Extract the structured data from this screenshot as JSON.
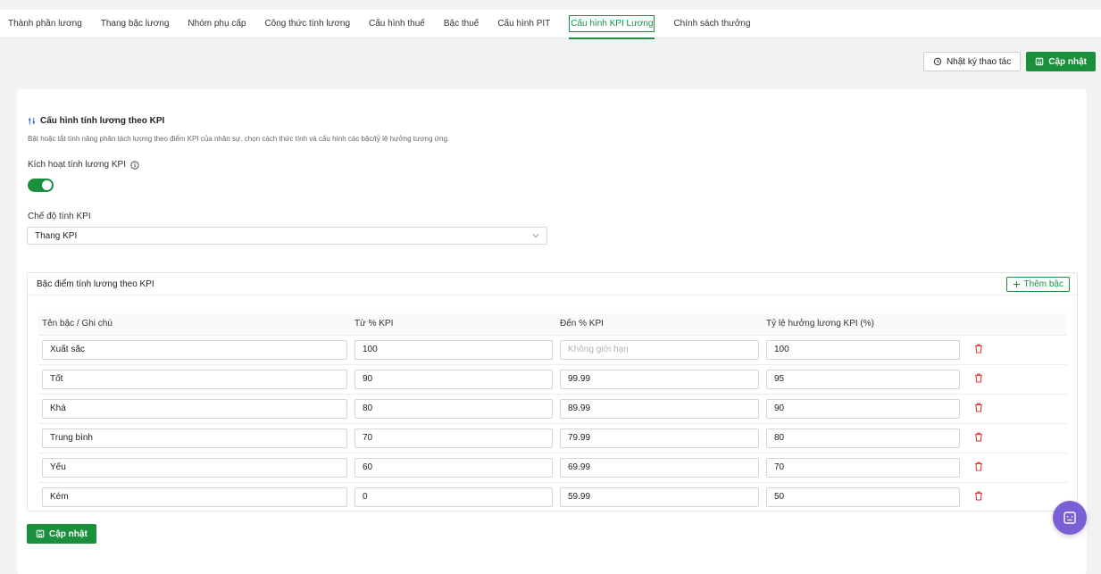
{
  "tabs": [
    {
      "label": "Thành phần lương",
      "active": false
    },
    {
      "label": "Thang bậc lương",
      "active": false
    },
    {
      "label": "Nhóm phụ cấp",
      "active": false
    },
    {
      "label": "Công thức tính lương",
      "active": false
    },
    {
      "label": "Cấu hình thuế",
      "active": false
    },
    {
      "label": "Bậc thuế",
      "active": false
    },
    {
      "label": "Cấu hình PIT",
      "active": false
    },
    {
      "label": "Cấu hình KPI Lương",
      "active": true
    },
    {
      "label": "Chính sách thưởng",
      "active": false
    }
  ],
  "toolbar": {
    "log_label": "Nhật ký thao tác",
    "update_label": "Cập nhật"
  },
  "section": {
    "title": "Cấu hình tính lương theo KPI",
    "description": "Bật hoặc tắt tính năng phân tách lương theo điểm KPI của nhân sự, chọn cách thức tính và cấu hình các bậc/tỷ lệ hưởng tương ứng.",
    "toggle_label": "Kích hoạt tính lương KPI",
    "toggle_on": true,
    "mode_label": "Chế độ tính KPI",
    "mode_value": "Thang KPI"
  },
  "tiers": {
    "title": "Bậc điểm tính lương theo KPI",
    "add_label": "Thêm bậc",
    "headers": [
      "Tên bậc / Ghi chú",
      "Từ % KPI",
      "Đến % KPI",
      "Tỷ lệ hưởng lương KPI (%)"
    ],
    "to_placeholder": "Không giới hạn",
    "rows": [
      {
        "name": "Xuất sắc",
        "from": "100",
        "to": "",
        "rate": "100"
      },
      {
        "name": "Tốt",
        "from": "90",
        "to": "99.99",
        "rate": "95"
      },
      {
        "name": "Khá",
        "from": "80",
        "to": "89.99",
        "rate": "90"
      },
      {
        "name": "Trung bình",
        "from": "70",
        "to": "79.99",
        "rate": "80"
      },
      {
        "name": "Yếu",
        "from": "60",
        "to": "69.99",
        "rate": "70"
      },
      {
        "name": "Kém",
        "from": "0",
        "to": "59.99",
        "rate": "50"
      }
    ]
  },
  "bottom": {
    "update_label": "Cập nhật"
  },
  "colors": {
    "accent": "#1a8f3c",
    "danger": "#e53935",
    "fab": "#7b5fd6"
  },
  "icons": [
    "history-icon",
    "save-icon",
    "plus-icon",
    "trash-icon",
    "info-icon",
    "chevron-down-icon",
    "sliders-icon",
    "chatbot-icon"
  ]
}
